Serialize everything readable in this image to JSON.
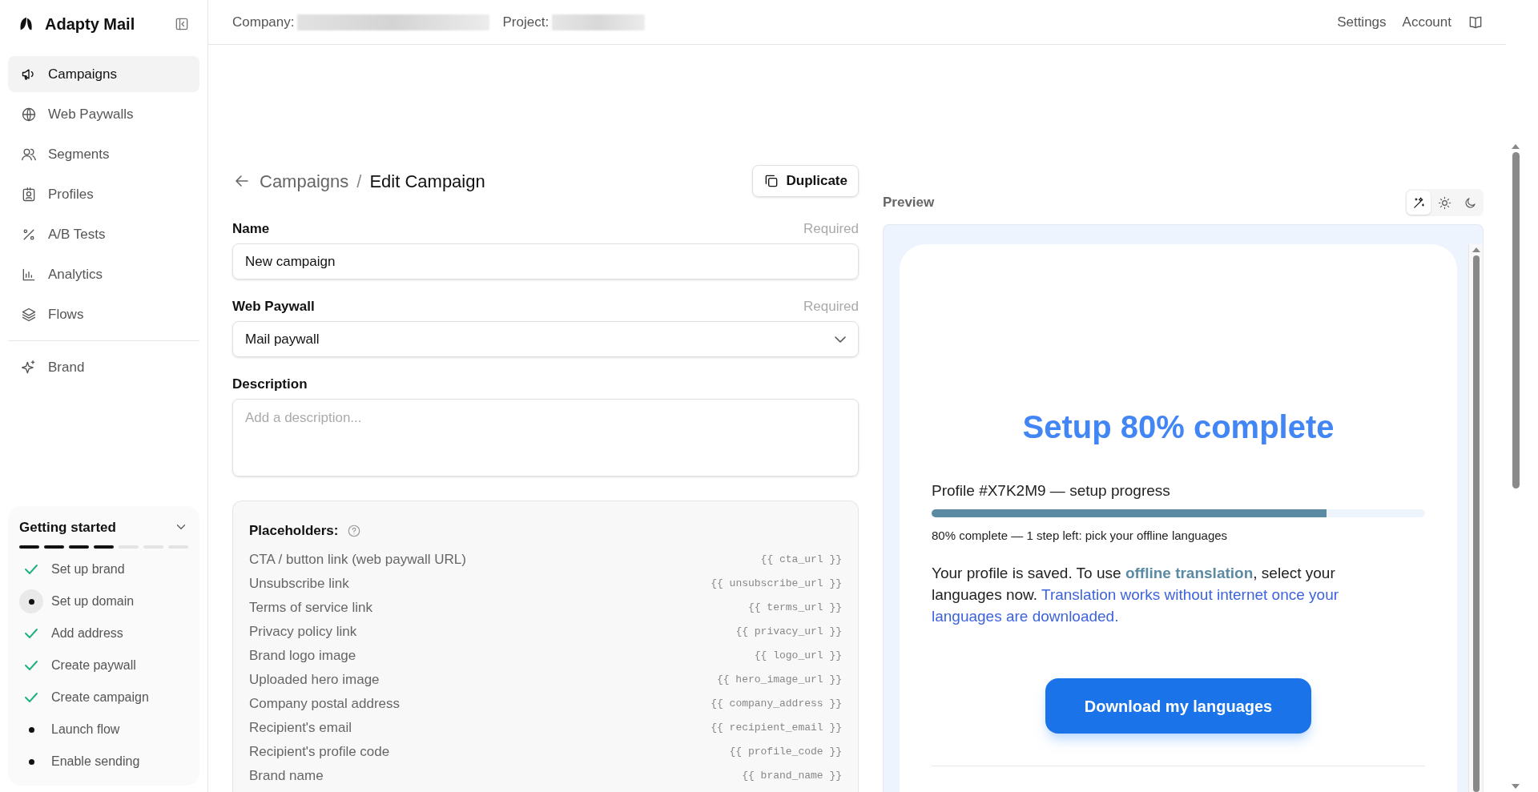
{
  "app": {
    "name": "Adapty Mail"
  },
  "header": {
    "company_label": "Company:",
    "project_label": "Project:",
    "links": [
      "Settings",
      "Account"
    ]
  },
  "sidebar": {
    "items": [
      {
        "kind": "megaphone",
        "label": "Campaigns",
        "selected": true
      },
      {
        "kind": "globe",
        "label": "Web Paywalls",
        "selected": false
      },
      {
        "kind": "users",
        "label": "Segments",
        "selected": false
      },
      {
        "kind": "badge",
        "label": "Profiles",
        "selected": false
      },
      {
        "kind": "percent",
        "label": "A/B Tests",
        "selected": false
      },
      {
        "kind": "chart",
        "label": "Analytics",
        "selected": false
      },
      {
        "kind": "layers",
        "label": "Flows",
        "selected": false
      },
      {
        "kind": "sparkles",
        "label": "Brand",
        "selected": false
      }
    ],
    "getting_started": {
      "title": "Getting started",
      "expanded": true,
      "segments": [
        {
          "done": true
        },
        {
          "done": true
        },
        {
          "done": true
        },
        {
          "done": true
        },
        {
          "done": false
        },
        {
          "done": false
        },
        {
          "done": false
        }
      ],
      "steps": [
        {
          "label": "Set up brand",
          "done": true,
          "selected": false
        },
        {
          "label": "Set up domain",
          "done": false,
          "selected": true
        },
        {
          "label": "Add address",
          "done": true,
          "selected": false
        },
        {
          "label": "Create paywall",
          "done": true,
          "selected": false
        },
        {
          "label": "Create campaign",
          "done": true,
          "selected": false
        },
        {
          "label": "Launch flow",
          "done": false,
          "selected": false
        },
        {
          "label": "Enable sending",
          "done": false,
          "selected": false
        }
      ]
    }
  },
  "breadcrumb": {
    "parent": "Campaigns",
    "separator": "/",
    "current": "Edit Campaign"
  },
  "duplicate_button": "Duplicate",
  "form": {
    "fields": [
      {
        "kind": "text",
        "label": "Name",
        "hint": "Required",
        "value": "New campaign"
      },
      {
        "kind": "select",
        "label": "Web Paywall",
        "hint": "Required",
        "value": "Mail paywall"
      },
      {
        "kind": "textarea",
        "label": "Description",
        "placeholder": "Add a description..."
      }
    ]
  },
  "placeholders": {
    "title": "Placeholders:",
    "rows": [
      {
        "label": "CTA / button link (web paywall URL)",
        "token": "{{ cta_url }}"
      },
      {
        "label": "Unsubscribe link",
        "token": "{{ unsubscribe_url }}"
      },
      {
        "label": "Terms of service link",
        "token": "{{ terms_url }}"
      },
      {
        "label": "Privacy policy link",
        "token": "{{ privacy_url }}"
      },
      {
        "label": "Brand logo image",
        "token": "{{ logo_url }}"
      },
      {
        "label": "Uploaded hero image",
        "token": "{{ hero_image_url }}"
      },
      {
        "label": "Company postal address",
        "token": "{{ company_address }}"
      },
      {
        "label": "Recipient's email",
        "token": "{{ recipient_email }}"
      },
      {
        "label": "Recipient's profile code",
        "token": "{{ profile_code }}"
      },
      {
        "label": "Brand name",
        "token": "{{ brand_name }}"
      }
    ]
  },
  "preview": {
    "title": "Preview",
    "theme_options": [
      {
        "kind": "auto",
        "selected": true
      },
      {
        "kind": "light",
        "selected": false
      },
      {
        "kind": "dark",
        "selected": false
      }
    ],
    "email": {
      "heading": "Setup 80% complete",
      "progress_label": "Profile #X7K2M9 — setup progress",
      "level": 0.8,
      "progress_caption": "80% complete — 1 step left: pick your offline languages",
      "body": [
        {
          "kind": "plain",
          "text": "Your profile is saved. To use "
        },
        {
          "kind": "highlight",
          "text": "offline translation"
        },
        {
          "kind": "plain",
          "text": ", select your languages now. "
        },
        {
          "kind": "link",
          "text": "Translation works without internet once your languages are downloaded."
        }
      ],
      "button": "Download my languages"
    }
  }
}
